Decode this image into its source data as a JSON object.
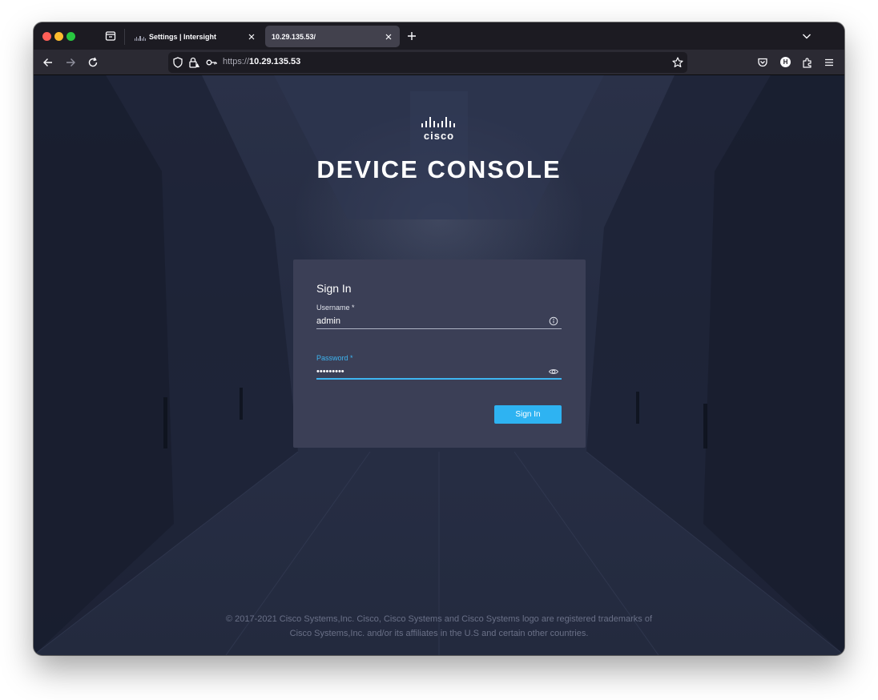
{
  "browser": {
    "tabs": [
      {
        "title": "Settings | Intersight",
        "active": false
      },
      {
        "title": "10.29.135.53/",
        "active": true
      }
    ],
    "url": {
      "scheme": "https://",
      "host": "10.29.135.53"
    },
    "profile_initial": "H",
    "icons": {
      "tab_list": "tab-list-icon",
      "new_tab": "plus-icon",
      "overflow": "chevron-down-icon",
      "back": "back-arrow-icon",
      "forward": "forward-arrow-icon",
      "reload": "reload-icon",
      "tracking": "shield-icon",
      "lock": "lock-warning-icon",
      "key": "key-icon",
      "bookmark": "star-icon",
      "pocket": "pocket-icon",
      "extensions": "puzzle-icon",
      "menu": "hamburger-menu-icon"
    }
  },
  "page": {
    "brand": "cisco",
    "title": "DEVICE CONSOLE",
    "signin": {
      "heading": "Sign In",
      "username_label": "Username *",
      "username_value": "admin",
      "password_label": "Password *",
      "password_value": "•••••••••",
      "submit_label": "Sign In"
    },
    "footer": {
      "line1": "© 2017-2021 Cisco Systems,Inc. Cisco, Cisco Systems and Cisco Systems logo are registered trademarks of",
      "line2": "Cisco Systems,Inc. and/or its affiliates in the U.S and certain other countries."
    }
  },
  "colors": {
    "accent": "#2eb3f2",
    "card": "#3b3f56",
    "background": "#262d43"
  }
}
